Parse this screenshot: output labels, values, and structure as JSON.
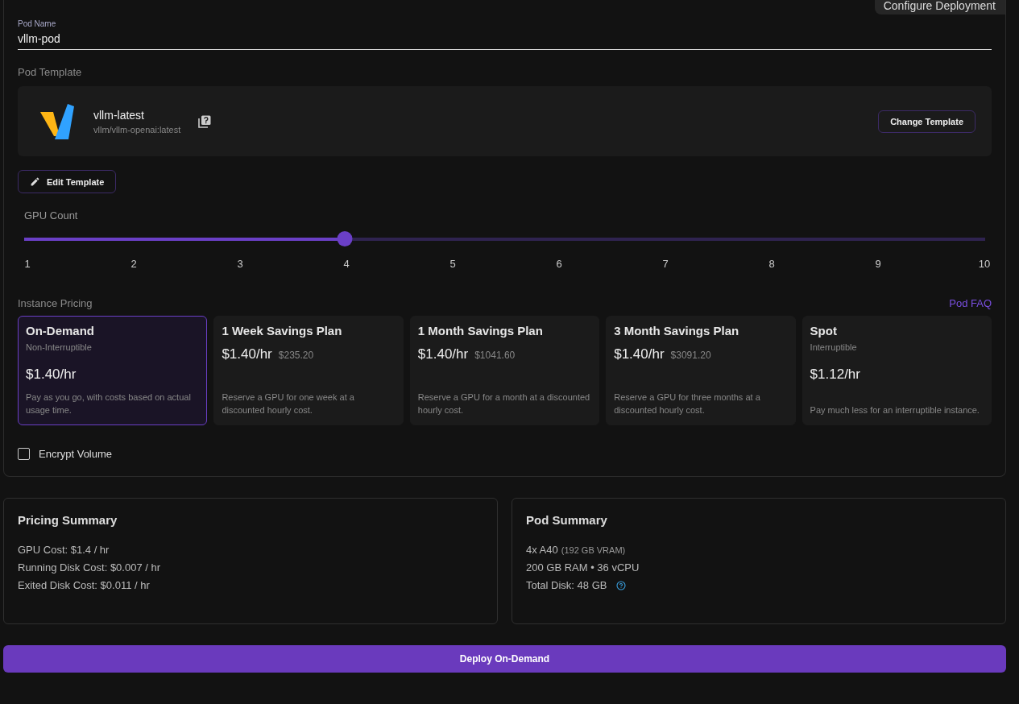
{
  "tab_label": "Configure Deployment",
  "pod_name": {
    "label": "Pod Name",
    "value": "vllm-pod"
  },
  "template": {
    "heading": "Pod Template",
    "name": "vllm-latest",
    "image": "vllm/vllm-openai:latest",
    "change_button": "Change Template",
    "edit_button": "Edit Template"
  },
  "gpu_count": {
    "label": "GPU Count",
    "level": 0.3333,
    "ticks": [
      "1",
      "2",
      "3",
      "4",
      "5",
      "6",
      "7",
      "8",
      "9",
      "10"
    ]
  },
  "pricing": {
    "heading": "Instance Pricing",
    "faq_link": "Pod FAQ",
    "plans": [
      {
        "kind": "flex",
        "title": "On-Demand",
        "subtitle": "Non-Interruptible",
        "price": "$1.40/hr",
        "description": "Pay as you go, with costs based on actual usage time.",
        "selected": true
      },
      {
        "kind": "savings",
        "title": "1 Week Savings Plan",
        "price": "$1.40/hr",
        "total": "$235.20",
        "description": "Reserve a GPU for one week at a discounted hourly cost.",
        "selected": false
      },
      {
        "kind": "savings",
        "title": "1 Month Savings Plan",
        "price": "$1.40/hr",
        "total": "$1041.60",
        "description": "Reserve a GPU for a month at a discounted hourly cost.",
        "selected": false
      },
      {
        "kind": "savings",
        "title": "3 Month Savings Plan",
        "price": "$1.40/hr",
        "total": "$3091.20",
        "description": "Reserve a GPU for three months at a discounted hourly cost.",
        "selected": false
      },
      {
        "kind": "flex",
        "title": "Spot",
        "subtitle": "Interruptible",
        "price": "$1.12/hr",
        "description": "Pay much less for an interruptible instance.",
        "selected": false
      }
    ]
  },
  "encrypt_volume": {
    "label": "Encrypt Volume",
    "checked": false
  },
  "pricing_summary": {
    "title": "Pricing Summary",
    "lines": [
      "GPU Cost: $1.4 / hr",
      "Running Disk Cost: $0.007 / hr",
      "Exited Disk Cost: $0.011 / hr"
    ]
  },
  "pod_summary": {
    "title": "Pod Summary",
    "gpu": "4x A40",
    "vram": "(192 GB VRAM)",
    "specs": "200 GB RAM • 36 vCPU",
    "disk": "Total Disk: 48 GB"
  },
  "deploy_button": "Deploy On-Demand"
}
